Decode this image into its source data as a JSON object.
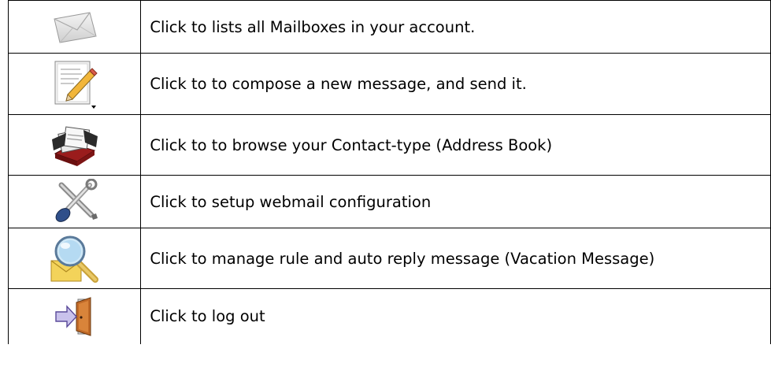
{
  "legend": {
    "rows": [
      {
        "icon": "envelope-icon",
        "text": "Click to lists all Mailboxes in your account."
      },
      {
        "icon": "compose-icon",
        "text": "Click to to compose a new message, and send it."
      },
      {
        "icon": "address-book-icon",
        "text": "Click to to browse your Contact-type (Address Book)"
      },
      {
        "icon": "tools-icon",
        "text": "Click to setup webmail configuration"
      },
      {
        "icon": "search-mail-icon",
        "text": "Click to manage rule and auto reply message (Vacation Message)"
      },
      {
        "icon": "logout-door-icon",
        "text": "Click to log out"
      }
    ]
  }
}
